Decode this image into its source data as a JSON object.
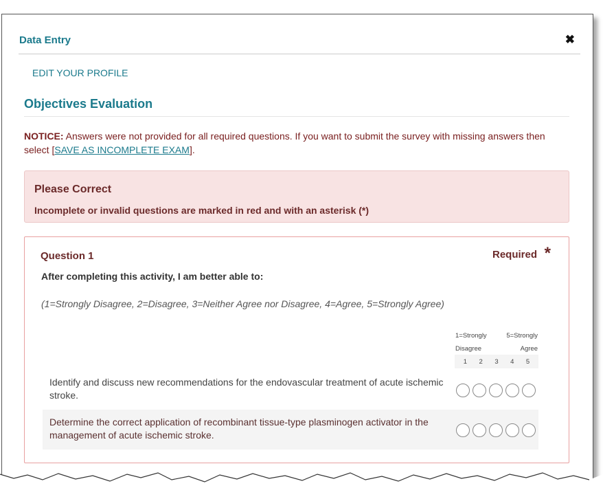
{
  "dialog": {
    "title": "Data Entry",
    "close_icon": "close-icon"
  },
  "nav": {
    "edit_profile": "EDIT YOUR PROFILE"
  },
  "section": {
    "title": "Objectives Evaluation"
  },
  "notice": {
    "label": "NOTICE:",
    "text_before": " Answers were not provided for all required questions. If you want to submit the survey with missing answers then select [",
    "link": "SAVE AS INCOMPLETE EXAM",
    "text_after": "]."
  },
  "alert": {
    "title": "Please Correct",
    "text": "Incomplete or invalid questions are marked in red and with an asterisk (*)"
  },
  "question": {
    "title": "Question 1",
    "required": "Required",
    "asterisk": "*",
    "prompt": "After completing this activity, I am better able to:",
    "scale_text": "(1=Strongly Disagree, 2=Disagree, 3=Neither Agree nor Disagree, 4=Agree, 5=Strongly Agree)",
    "scale_header": {
      "left_line1": "1=Strongly",
      "left_line2": "Disagree",
      "right_line1": "5=Strongly",
      "right_line2": "Agree",
      "numbers": [
        "1",
        "2",
        "3",
        "4",
        "5"
      ]
    },
    "items": [
      {
        "text": "Identify and discuss new recommendations for the endovascular treatment of acute ischemic stroke."
      },
      {
        "text": "Determine the correct application of recombinant tissue-type plasminogen activator in the management of acute ischemic stroke."
      }
    ]
  }
}
